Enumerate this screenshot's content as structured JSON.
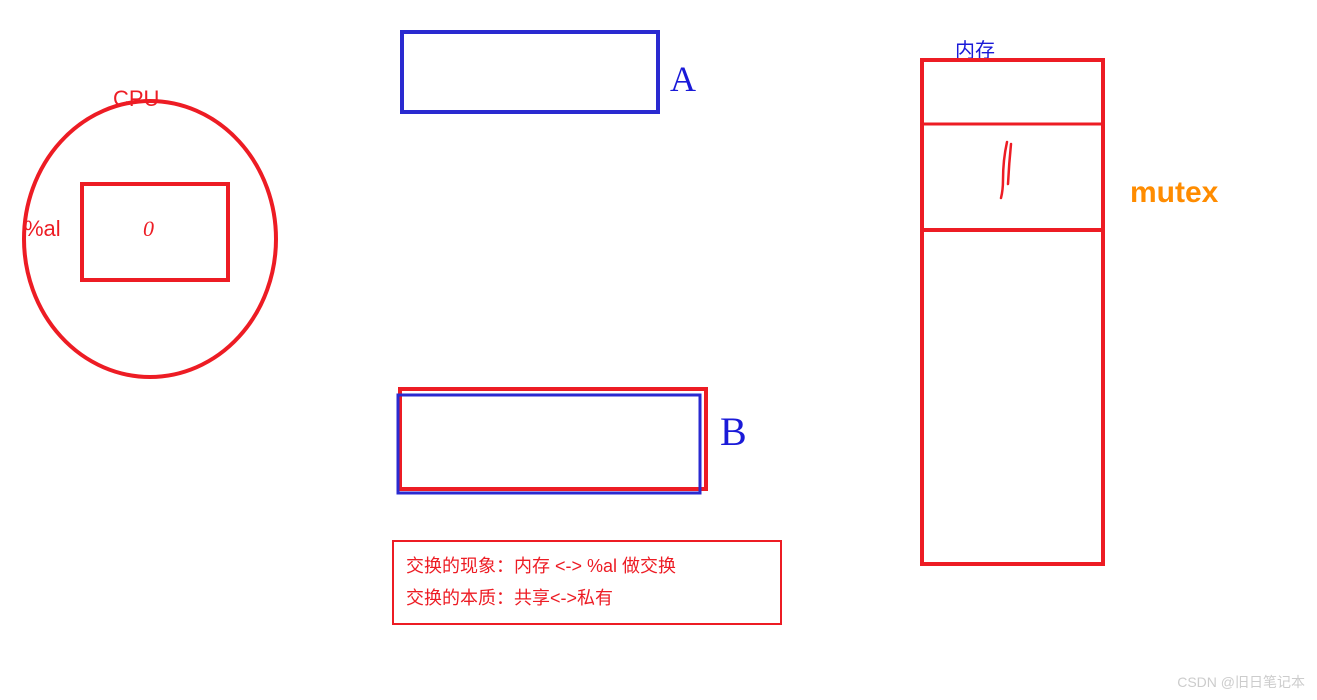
{
  "cpu": {
    "label": "CPU",
    "register_label": "%al",
    "register_value": "0"
  },
  "threads": {
    "a_label": "A",
    "b_label": "B"
  },
  "memory": {
    "label": "内存",
    "mutex_label": "mutex",
    "mutex_value": "1"
  },
  "note": {
    "line1": "交换的现象：内存 <-> %al 做交换",
    "line2": "交换的本质：共享<->私有"
  },
  "watermark": "CSDN @旧日笔记本"
}
